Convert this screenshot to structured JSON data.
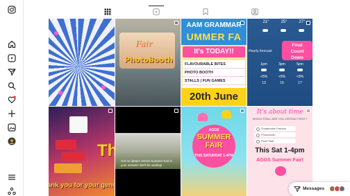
{
  "nav": {
    "items": [
      {
        "icon": "instagram-logo-icon"
      },
      {
        "icon": "home-icon"
      },
      {
        "icon": "reels-icon"
      },
      {
        "icon": "send-icon"
      },
      {
        "icon": "search-icon"
      },
      {
        "icon": "heart-icon",
        "badge": true
      },
      {
        "icon": "plus-icon"
      },
      {
        "icon": "media-icon"
      },
      {
        "icon": "profile-avatar"
      },
      {
        "icon": "menu-icon"
      },
      {
        "icon": "meta-icon"
      }
    ]
  },
  "tabs": [
    {
      "icon": "grid-icon",
      "active": true
    },
    {
      "icon": "reels-tab-icon",
      "active": false
    },
    {
      "icon": "bookmark-icon",
      "active": false
    },
    {
      "icon": "tagged-icon",
      "active": false
    }
  ],
  "posts": {
    "photobooth": {
      "label": "PhotoBooth",
      "script": "Fair"
    },
    "poster": {
      "title_line1": "AAM GRAMMAR",
      "title_line2": "UMMER FA",
      "today": "It's TODAY!!",
      "items": [
        "FLAVOURABLE BITES",
        "PHOTO BOOTH",
        "STALLS | FUN GAMES"
      ],
      "date": "20th June"
    },
    "weather": {
      "temps": [
        "21°",
        "25°",
        "27°"
      ],
      "forecast_label": "Hourly forecast",
      "countdown": [
        "Final",
        "Count",
        "Down"
      ],
      "times": [
        "1pm",
        "3pm",
        "5pm"
      ],
      "percent": [
        "<5%",
        "<5%",
        "<5%"
      ],
      "wind": [
        "13",
        "15",
        "17"
      ]
    },
    "thanks": {
      "text": "ank you for your gener",
      "big": "Th"
    },
    "video": {
      "caption": "Got no ideas? AGGS Summer Fair is your answer! We'll be waiting!"
    },
    "flyer": {
      "school": "AGGS",
      "line1": "SUMMER",
      "line2": "FAIR",
      "date": "THIS SATURDAY 1-4PM"
    },
    "about": {
      "title": "It's about time",
      "subtitle": "WHICH STALL ARE YOU VISITING FIRST?",
      "options": [
        "Sustainable Fashion",
        "Photobooth",
        "Plant Stall"
      ],
      "time": "This Sat 1-4pm",
      "event": "AGGS Summer Fair!"
    }
  },
  "messages": {
    "label": "Messages"
  },
  "colors": {
    "accent": "#ff3f8a",
    "tab_active": "#262626",
    "border": "#e6e6e6"
  }
}
